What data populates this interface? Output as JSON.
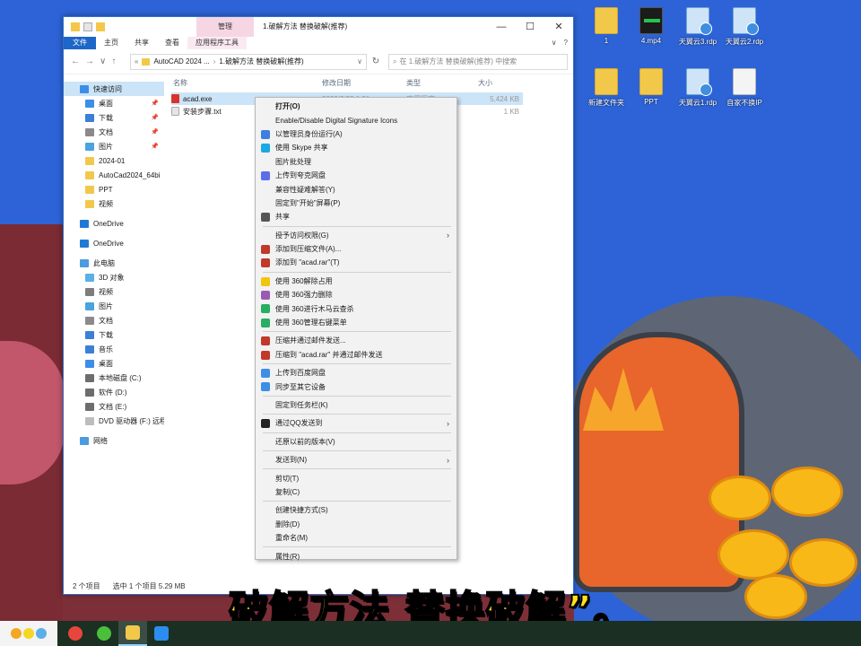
{
  "window": {
    "title": "1.破解方法 替换破解(推荐)",
    "manage_tab": "管理",
    "controls": {
      "minimize": "—",
      "maximize": "☐",
      "close": "✕"
    }
  },
  "ribbon": {
    "file": "文件",
    "tabs": [
      "主页",
      "共享",
      "查看",
      "应用程序工具"
    ],
    "expand": "∨",
    "help": "?"
  },
  "address": {
    "nav": {
      "back": "←",
      "forward": "→",
      "recent": "∨",
      "up": "↑"
    },
    "overflow": "«",
    "segments": [
      "AutoCAD 2024 ...",
      "1.破解方法 替换破解(推荐)"
    ],
    "separator": "›",
    "dropdown": "∨",
    "refresh": "↻",
    "search_placeholder": "在 1.破解方法 替换破解(推荐) 中搜索"
  },
  "sidebar": {
    "items": [
      {
        "label": "快速访问",
        "color": "#3c8ee6",
        "pinned": false,
        "selected": true
      },
      {
        "label": "桌面",
        "color": "#3c8ee6",
        "pinned": true
      },
      {
        "label": "下载",
        "color": "#3c7fd6",
        "pinned": true
      },
      {
        "label": "文档",
        "color": "#8a8a8a",
        "pinned": true
      },
      {
        "label": "图片",
        "color": "#4aa3df",
        "pinned": true
      },
      {
        "label": "2024-01",
        "color": "#f2c84b",
        "pinned": false
      },
      {
        "label": "AutoCad2024_64bi",
        "color": "#f2c84b",
        "pinned": false
      },
      {
        "label": "PPT",
        "color": "#f2c84b",
        "pinned": false
      },
      {
        "label": "视频",
        "color": "#f2c84b",
        "pinned": false
      },
      {
        "label": "OneDrive",
        "color": "#1f7ad6",
        "pinned": false,
        "gap": true
      },
      {
        "label": "OneDrive",
        "color": "#1f7ad6",
        "pinned": false,
        "gap": true
      },
      {
        "label": "此电脑",
        "color": "#4a9be0",
        "pinned": false,
        "gap": true
      },
      {
        "label": "3D 对象",
        "color": "#5ab0e6",
        "pinned": false
      },
      {
        "label": "视频",
        "color": "#7d7d7d",
        "pinned": false
      },
      {
        "label": "图片",
        "color": "#4aa3df",
        "pinned": false
      },
      {
        "label": "文档",
        "color": "#8a8a8a",
        "pinned": false
      },
      {
        "label": "下载",
        "color": "#3c7fd6",
        "pinned": false
      },
      {
        "label": "音乐",
        "color": "#3c7fd6",
        "pinned": false
      },
      {
        "label": "桌面",
        "color": "#3c8ee6",
        "pinned": false
      },
      {
        "label": "本地磁盘 (C:)",
        "color": "#6d6d6d",
        "pinned": false
      },
      {
        "label": "软件 (D:)",
        "color": "#6d6d6d",
        "pinned": false
      },
      {
        "label": "文档 (E:)",
        "color": "#6d6d6d",
        "pinned": false
      },
      {
        "label": "DVD 驱动器 (F:) 远程",
        "color": "#bdbdbd",
        "pinned": false
      },
      {
        "label": "网络",
        "color": "#4a9be0",
        "pinned": false,
        "gap": true
      }
    ],
    "pin_glyph": "📌"
  },
  "columns": {
    "name": "名称",
    "modified": "修改日期",
    "type": "类型",
    "size": "大小"
  },
  "files": [
    {
      "name": "acad.exe",
      "date": "2023/2/23 1:51",
      "type": "应用程序",
      "size": "5,424 KB",
      "color": "#d9342b",
      "selected": true
    },
    {
      "name": "安装步骤.txt",
      "date": "",
      "type": "",
      "size": "1 KB",
      "color": "#e5e5e5",
      "selected": false
    }
  ],
  "status": {
    "count": "2 个项目",
    "selection": "选中 1 个项目  5.29 MB"
  },
  "context_menu": [
    {
      "label": "打开(O)",
      "bold": true
    },
    {
      "label": "Enable/Disable Digital Signature Icons"
    },
    {
      "label": "以管理员身份运行(A)",
      "icon": "#3d7ee0"
    },
    {
      "label": "使用 Skype 共享",
      "icon": "#19a9e5"
    },
    {
      "label": "图片批处理"
    },
    {
      "label": "上传到夸克网盘",
      "icon": "#5b6ee8"
    },
    {
      "label": "兼容性疑难解答(Y)"
    },
    {
      "label": "固定到\"开始\"屏幕(P)"
    },
    {
      "label": "共享",
      "icon": "#555555"
    },
    {
      "sep": true
    },
    {
      "label": "授予访问权限(G)",
      "arrow": true
    },
    {
      "label": "添加到压缩文件(A)...",
      "icon": "#c0392b"
    },
    {
      "label": "添加到 \"acad.rar\"(T)",
      "icon": "#c0392b"
    },
    {
      "sep": true
    },
    {
      "label": "使用 360解除占用",
      "icon": "#f1c40f"
    },
    {
      "label": "使用 360强力删除",
      "icon": "#9b59b6"
    },
    {
      "label": "使用 360进行木马云查杀",
      "icon": "#27ae60"
    },
    {
      "label": "使用 360管理右键菜单",
      "icon": "#27ae60"
    },
    {
      "sep": true
    },
    {
      "label": "压缩并通过邮件发送...",
      "icon": "#c0392b"
    },
    {
      "label": "压缩到 \"acad.rar\" 并通过邮件发送",
      "icon": "#c0392b"
    },
    {
      "sep": true
    },
    {
      "label": "上传到百度网盘",
      "icon": "#3c8ee6"
    },
    {
      "label": "同步至其它设备",
      "icon": "#3c8ee6"
    },
    {
      "sep": true
    },
    {
      "label": "固定到任务栏(K)"
    },
    {
      "sep": true
    },
    {
      "label": "通过QQ发送到",
      "icon": "#222222",
      "arrow": true
    },
    {
      "sep": true
    },
    {
      "label": "还原以前的版本(V)"
    },
    {
      "sep": true
    },
    {
      "label": "发送到(N)",
      "arrow": true
    },
    {
      "sep": true
    },
    {
      "label": "剪切(T)"
    },
    {
      "label": "复制(C)"
    },
    {
      "sep": true
    },
    {
      "label": "创建快捷方式(S)"
    },
    {
      "label": "删除(D)"
    },
    {
      "label": "重命名(M)"
    },
    {
      "sep": true
    },
    {
      "label": "属性(R)"
    }
  ],
  "menu_arrow": "›",
  "desktop_icons": [
    {
      "label": "1",
      "kind": "folder"
    },
    {
      "label": "4.mp4",
      "kind": "video"
    },
    {
      "label": "天翼云3.rdp",
      "kind": "rdp"
    },
    {
      "label": "天翼云2.rdp",
      "kind": "rdp"
    },
    {
      "label": "新建文件夹",
      "kind": "folder"
    },
    {
      "label": "PPT",
      "kind": "folder"
    },
    {
      "label": "天翼云1.rdp",
      "kind": "rdp"
    },
    {
      "label": "自家不换IP",
      "kind": "file"
    }
  ],
  "subtitle": "破解方法 替换破解”。",
  "taskbar": {
    "apps": [
      {
        "name": "chrome",
        "color": "#e8453c",
        "active": false
      },
      {
        "name": "360-browser",
        "color": "#4bbf3a",
        "active": false
      },
      {
        "name": "file-explorer",
        "color": "#f2c84b",
        "active": true
      },
      {
        "name": "meeting-app",
        "color": "#2d8cf0",
        "active": false
      }
    ]
  }
}
